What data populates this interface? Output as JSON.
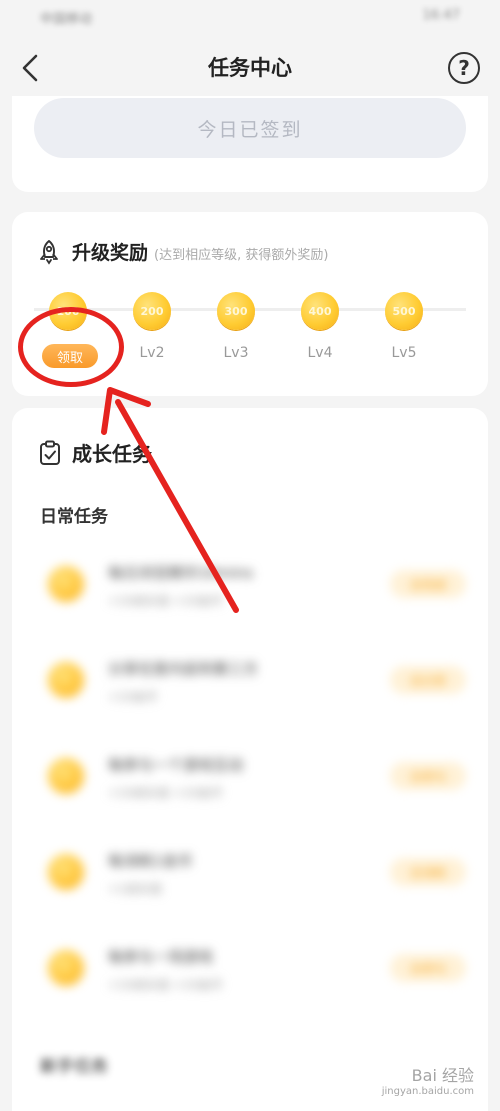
{
  "status": {
    "left": "中国移动",
    "right": "16:47"
  },
  "nav": {
    "title": "任务中心"
  },
  "checkin": {
    "label": "今日已签到"
  },
  "upgrade": {
    "title": "升级奖励",
    "subtitle": "(达到相应等级, 获得额外奖励)",
    "levels": [
      {
        "coin": "100",
        "label": "领取"
      },
      {
        "coin": "200",
        "label": "Lv2"
      },
      {
        "coin": "300",
        "label": "Lv3"
      },
      {
        "coin": "400",
        "label": "Lv4"
      },
      {
        "coin": "500",
        "label": "Lv5"
      }
    ]
  },
  "growth": {
    "title": "成长任务",
    "daily_title": "日常任务",
    "tasks": [
      {
        "name": "每日浏览精华10mins",
        "reward": "+10成长值 +10金币",
        "button": "去完成"
      },
      {
        "name": "分享任意内容到第三方",
        "reward": "+10金币",
        "button": "去分享"
      },
      {
        "name": "每参与一个游戏互动",
        "reward": "+10成长值 +10金币",
        "button": "去参与"
      },
      {
        "name": "每消耗1金币",
        "reward": "+1成长值",
        "button": "去消耗"
      },
      {
        "name": "每参与一场游戏",
        "reward": "+10成长值 +10金币",
        "button": "去参与"
      }
    ],
    "new_title": "新手任务"
  },
  "watermark": {
    "brand": "Bai 经验",
    "site": "jingyan.baidu.com"
  },
  "colors": {
    "accent": "#f99a2a",
    "coin": "#ffcc33",
    "annotation": "#e5231f"
  }
}
